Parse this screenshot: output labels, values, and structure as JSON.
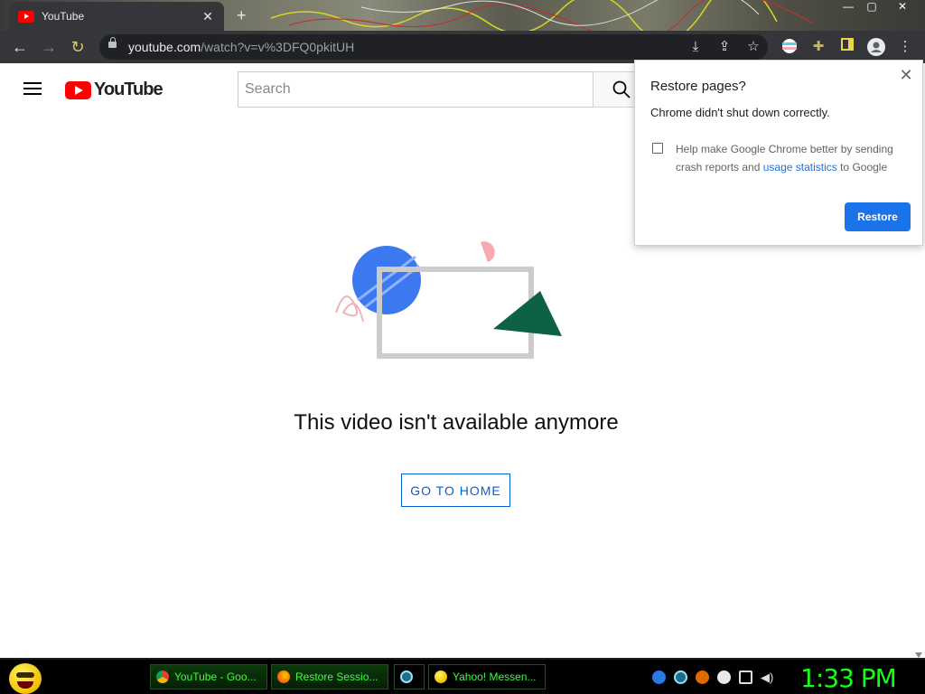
{
  "browser": {
    "tab": {
      "title": "YouTube"
    },
    "window_controls": {
      "minimize": "—",
      "maximize": "▢",
      "close": "✕"
    },
    "toolbar": {
      "url_domain": "youtube.com",
      "url_path": "/watch?v=v%3DFQ0pkitUH",
      "back": "←",
      "forward": "→",
      "reload": "↻"
    }
  },
  "youtube": {
    "logo_text": "YouTube",
    "search": {
      "placeholder": "Search"
    },
    "error": {
      "message": "This video isn't available anymore",
      "button_label": "GO TO HOME"
    }
  },
  "restore_popup": {
    "title": "Restore pages?",
    "subtitle": "Chrome didn't shut down correctly.",
    "checkbox_text_before": "Help make Google Chrome better by sending crash reports and ",
    "checkbox_link": "usage statistics",
    "checkbox_text_after": " to Google",
    "checked": false,
    "button_label": "Restore"
  },
  "taskbar": {
    "tasks": [
      {
        "label": "YouTube - Goo...",
        "icon": "chrome-icon",
        "active": true
      },
      {
        "label": "Restore Sessio...",
        "icon": "firefox-icon",
        "active": true
      },
      {
        "label": "",
        "icon": "vpn-icon",
        "active": false
      },
      {
        "label": "Yahoo! Messen...",
        "icon": "yahoo-messenger-icon",
        "active": false
      }
    ],
    "clock": "1:33 PM"
  },
  "colors": {
    "youtube_red": "#ff0000",
    "link_blue": "#065fd4",
    "chrome_blue": "#1a73e8",
    "clock_green": "#14ff14"
  }
}
